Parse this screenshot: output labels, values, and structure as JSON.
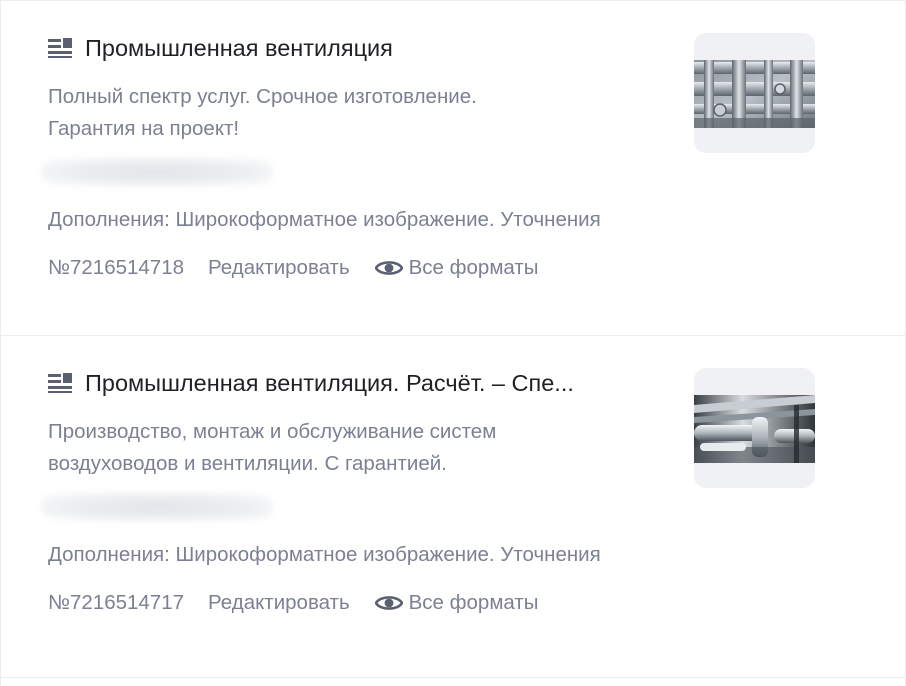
{
  "ads": [
    {
      "title": "Промышленная вентиляция",
      "description_lines": [
        "Полный спектр услуг. Срочное изготовление.",
        "Гарантия на проект!"
      ],
      "extras": "Дополнения: Широкоформатное изображение. Уточнения",
      "id": "№7216514718",
      "edit_label": "Редактировать",
      "formats_label": "Все форматы"
    },
    {
      "title": "Промышленная вентиляция. Расчёт. – Спе...",
      "description_lines": [
        "Производство, монтаж и обслуживание систем",
        "воздуховодов и вентиляции. С гарантией."
      ],
      "extras": "Дополнения: Широкоформатное изображение. Уточнения",
      "id": "№7216514717",
      "edit_label": "Редактировать",
      "formats_label": "Все форматы"
    }
  ],
  "icons": {
    "ad_type": "text-ad-icon",
    "formats": "eye-icon"
  },
  "colors": {
    "title": "#1f2125",
    "secondary_text": "#7b8193",
    "icon": "#5b6070",
    "divider": "#ebecef",
    "thumb_bg": "#f0f1f4"
  }
}
